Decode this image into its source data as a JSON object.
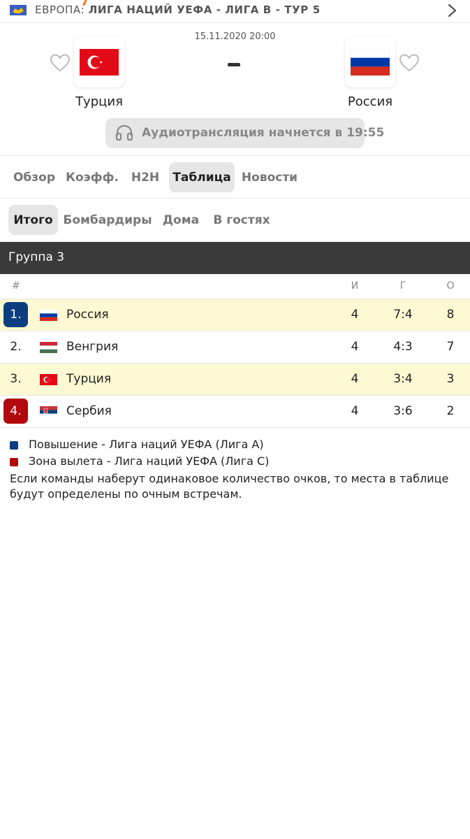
{
  "topbar": {
    "country": "ЕВРОПА:",
    "league": "ЛИГА НАЦИЙ УЕФА - ЛИГА B - ТУР 5",
    "flag_icon": "eu-flag-icon",
    "chevron_icon": "chevron-right-icon"
  },
  "match": {
    "datetime": "15.11.2020 20:00",
    "home": {
      "name": "Турция",
      "flag": "turkey-flag-icon"
    },
    "away": {
      "name": "Россия",
      "flag": "russia-flag-icon"
    },
    "score_separator": "-",
    "audio_text": "Аудиотрансляция начнется в 19:55",
    "audio_icon": "headphones-icon"
  },
  "tabs": [
    {
      "label": "Обзор",
      "active": false
    },
    {
      "label": "Коэфф.",
      "active": false
    },
    {
      "label": "H2H",
      "active": false
    },
    {
      "label": "Таблица",
      "active": true
    },
    {
      "label": "Новости",
      "active": false
    }
  ],
  "subtabs": [
    {
      "label": "Итого",
      "active": true
    },
    {
      "label": "Бомбардиры",
      "active": false
    },
    {
      "label": "Дома",
      "active": false
    },
    {
      "label": "В гостях",
      "active": false
    }
  ],
  "group": {
    "title": "Группа 3",
    "columns": {
      "rank": "#",
      "played": "И",
      "goals": "Г",
      "points": "О"
    },
    "rows": [
      {
        "rank": "1.",
        "team": "Россия",
        "played": "4",
        "goals": "7:4",
        "points": "8",
        "flag": "russia-flag-icon",
        "zone": "promotion",
        "highlight": true
      },
      {
        "rank": "2.",
        "team": "Венгрия",
        "played": "4",
        "goals": "4:3",
        "points": "7",
        "flag": "hungary-flag-icon",
        "zone": "",
        "highlight": false
      },
      {
        "rank": "3.",
        "team": "Турция",
        "played": "4",
        "goals": "3:4",
        "points": "3",
        "flag": "turkey-flag-icon",
        "zone": "",
        "highlight": true
      },
      {
        "rank": "4.",
        "team": "Сербия",
        "played": "4",
        "goals": "3:6",
        "points": "2",
        "flag": "serbia-flag-icon",
        "zone": "relegation",
        "highlight": false
      }
    ]
  },
  "legend": {
    "promotion": {
      "text": "Повышение - Лига наций УЕФА (Лига A)",
      "color": "#0c3e7f"
    },
    "relegation": {
      "text": "Зона вылета - Лига наций УЕФА (Лига C)",
      "color": "#b0080c"
    },
    "note": "Если команды наберут одинаковое количество очков, то места в таблице будут определены по очным встречам."
  },
  "colors": {
    "accent_promotion": "#0c3e7f",
    "accent_relegation": "#b0080c",
    "highlight_row": "#fdf9d3",
    "group_header": "#3a3a3a"
  }
}
